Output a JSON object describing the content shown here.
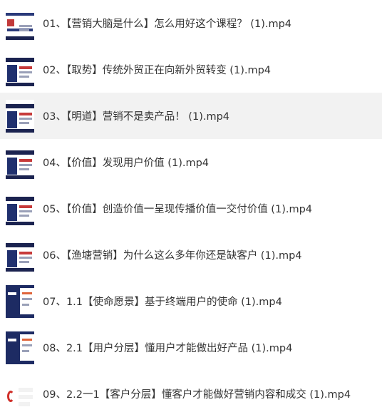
{
  "files": [
    {
      "name": "01、【营销大脑是什么】怎么用好这个课程？ (1).mp4",
      "selected": false,
      "thumbnail": "slide-thumbnail-title"
    },
    {
      "name": "02、【取势】传统外贸正在向新外贸转变 (1).mp4",
      "selected": false,
      "thumbnail": "slide-thumbnail-navy"
    },
    {
      "name": "03、【明道】营销不是卖产品！ (1).mp4",
      "selected": true,
      "thumbnail": "slide-thumbnail-navy"
    },
    {
      "name": "04、【价值】发现用户价值 (1).mp4",
      "selected": false,
      "thumbnail": "slide-thumbnail-navy"
    },
    {
      "name": "05、【价值】创造价值一呈现传播价值一交付价值 (1).mp4",
      "selected": false,
      "thumbnail": "slide-thumbnail-navy"
    },
    {
      "name": "06、【渔塘营销】为什么这么多年你还是缺客户 (1).mp4",
      "selected": false,
      "thumbnail": "slide-thumbnail-navy"
    },
    {
      "name": "07、1.1【使命愿景】基于终端用户的使命 (1).mp4",
      "selected": false,
      "thumbnail": "slide-thumbnail-dark"
    },
    {
      "name": "08、2.1【用户分层】懂用户才能做出好产品 (1).mp4",
      "selected": false,
      "thumbnail": "slide-thumbnail-dark"
    },
    {
      "name": "09、2.2一1【客户分层】懂客户才能做好营销内容和成交 (1).mp4",
      "selected": false,
      "thumbnail": "slide-thumbnail-red-logo"
    }
  ],
  "colors": {
    "selected_row_bg": "#f2f2f2",
    "text": "#333333",
    "slide_navy": "#1b2350",
    "slide_red": "#c73a3a"
  }
}
